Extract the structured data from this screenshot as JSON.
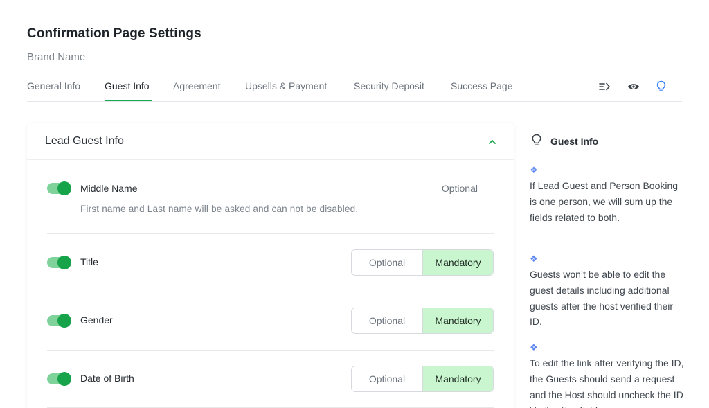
{
  "header": {
    "title": "Confirmation Page Settings",
    "subtitle": "Brand Name"
  },
  "tabs": [
    {
      "label": "General Info",
      "active": false
    },
    {
      "label": "Guest Info",
      "active": true
    },
    {
      "label": "Agreement",
      "active": false
    },
    {
      "label": "Upsells & Payment",
      "active": false
    },
    {
      "label": "Security Deposit",
      "active": false
    },
    {
      "label": "Success Page",
      "active": false
    }
  ],
  "toolbar_icons": [
    "list-collapse-icon",
    "eye-icon",
    "lightbulb-icon"
  ],
  "accent_color": "#18a957",
  "section": {
    "title": "Lead Guest Info",
    "expanded": true,
    "fields": [
      {
        "label": "Middle Name",
        "enabled": true,
        "requirement": "Optional",
        "hint": "First name and Last name will be asked and can not be disabled."
      },
      {
        "label": "Title",
        "enabled": true,
        "requirement": "Mandatory"
      },
      {
        "label": "Gender",
        "enabled": true,
        "requirement": "Mandatory"
      },
      {
        "label": "Date of Birth",
        "enabled": true,
        "requirement": "Mandatory"
      }
    ],
    "options": {
      "optional": "Optional",
      "mandatory": "Mandatory"
    }
  },
  "sidebar": {
    "title": "Guest Info",
    "bullet_symbol": "❖",
    "tips": [
      "If Lead Guest and Person Booking is one person, we will sum up the fields related to both.",
      "Guests won’t be able to edit the guest details including additional guests after the host verified their ID.",
      "To edit the link after verifying the ID, the Guests should send a request and the Host should uncheck the ID Verification field."
    ]
  }
}
